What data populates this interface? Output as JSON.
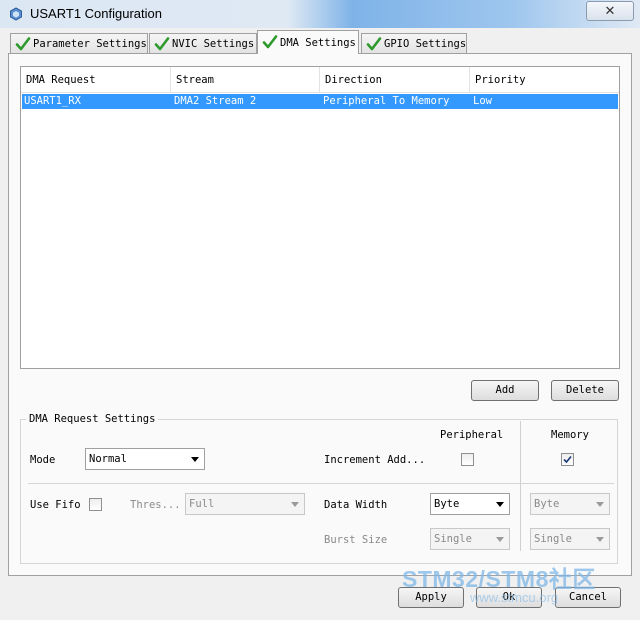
{
  "window": {
    "title": "USART1 Configuration",
    "close_label": "✕"
  },
  "tabs": [
    {
      "label": "Parameter Settings"
    },
    {
      "label": "NVIC Settings"
    },
    {
      "label": "DMA Settings"
    },
    {
      "label": "GPIO Settings"
    }
  ],
  "active_tab": "DMA Settings",
  "dma_table": {
    "headers": [
      "DMA Request",
      "Stream",
      "Direction",
      "Priority"
    ],
    "rows": [
      {
        "request": "USART1_RX",
        "stream": "DMA2 Stream 2",
        "direction": "Peripheral To Memory",
        "priority": "Low",
        "selected": true
      }
    ]
  },
  "buttons": {
    "add": "Add",
    "delete": "Delete",
    "apply": "Apply",
    "ok": "Ok",
    "cancel": "Cancel"
  },
  "settings": {
    "group_title": "DMA Request Settings",
    "peripheral_header": "Peripheral",
    "memory_header": "Memory",
    "mode_label": "Mode",
    "mode_value": "Normal",
    "increment_label": "Increment Add...",
    "increment_peripheral": false,
    "increment_memory": true,
    "use_fifo_label": "Use Fifo",
    "use_fifo": false,
    "threshold_label": "Thres...",
    "threshold_value": "Full",
    "data_width_label": "Data Width",
    "peripheral_data_width": "Byte",
    "memory_data_width": "Byte",
    "burst_size_label": "Burst Size",
    "peripheral_burst": "Single",
    "memory_burst": "Single"
  },
  "watermark": {
    "text": "STM32/STM8社区",
    "url": "www.stmcu.org"
  },
  "colors": {
    "selection": "#3399ff",
    "check_green": "#2e9a2e"
  },
  "icons": [
    "app-icon",
    "close-icon",
    "check-icon",
    "dropdown-arrow-icon",
    "checkbox-check-icon"
  ]
}
